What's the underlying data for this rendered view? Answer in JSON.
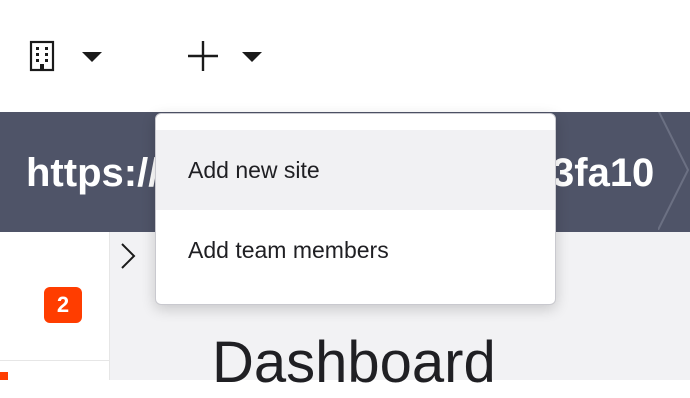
{
  "topbar": {
    "org_switcher_icon": "building-icon",
    "add_icon": "plus-icon",
    "caret_icon": "caret-down-icon"
  },
  "url_banner": {
    "left_text": "https://",
    "right_text": "3fa10"
  },
  "dropdown": {
    "items": [
      {
        "label": "Add new site",
        "highlighted": true
      },
      {
        "label": "Add team members"
      }
    ]
  },
  "sidebar": {
    "badge_count": "2",
    "badge_color": "#ff3d00"
  },
  "main": {
    "title": "Dashboard"
  },
  "colors": {
    "url_banner_bg": "#4f5468",
    "content_bg": "#f2f2f4",
    "accent": "#ff3d00"
  }
}
